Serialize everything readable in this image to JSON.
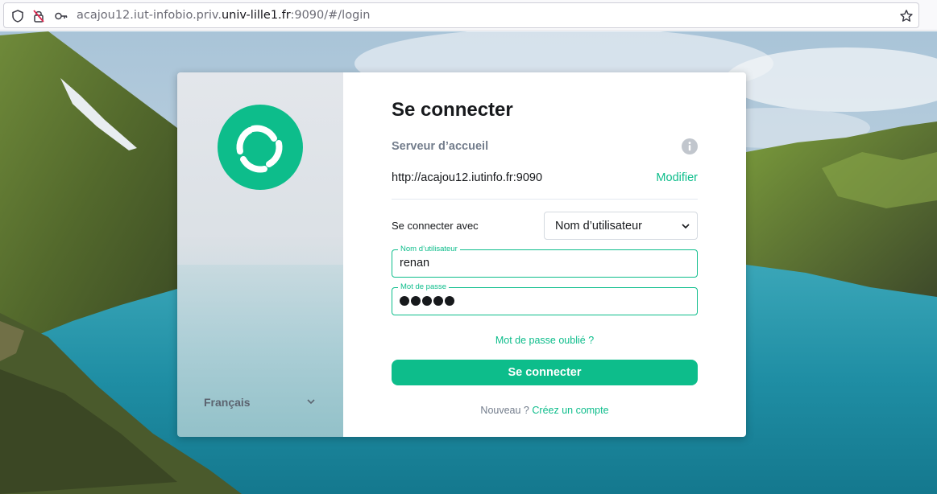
{
  "browser": {
    "url_prefix": "acajou12.iut-infobio.priv.",
    "url_domain": "univ-lille1.fr",
    "url_suffix": ":9090/#/login",
    "icons": [
      "shield-icon",
      "no-tracking-icon",
      "key-icon",
      "bookmark-star-icon"
    ]
  },
  "sidebar": {
    "logo_icon": "element-logo-icon",
    "language": "Français",
    "language_chevron": "chevron-down-icon"
  },
  "login": {
    "title": "Se connecter",
    "homeserver_label": "Serveur d’accueil",
    "homeserver_url": "http://acajou12.iutinfo.fr:9090",
    "homeserver_edit": "Modifier",
    "login_with_label": "Se connecter avec",
    "login_with_value": "Nom d’utilisateur",
    "username_label": "Nom d’utilisateur",
    "username_value": "renan",
    "password_label": "Mot de passe",
    "password_length": 5,
    "forgot_password": "Mot de passe oublié ?",
    "submit_label": "Se connecter",
    "new_prefix": "Nouveau ?",
    "create_account": "Créez un compte"
  },
  "colors": {
    "accent": "#0dbd8b",
    "text": "#17191c",
    "muted": "#737d8c"
  }
}
